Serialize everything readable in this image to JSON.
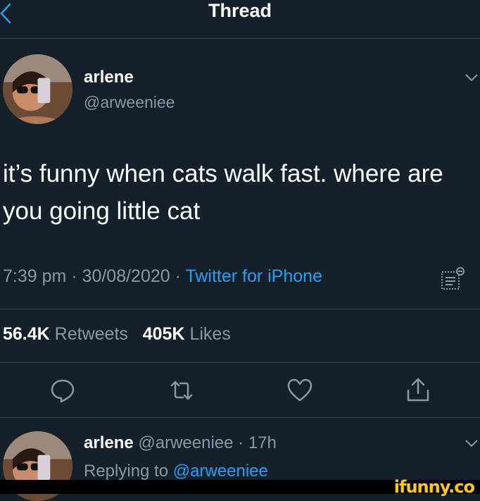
{
  "header": {
    "title": "Thread"
  },
  "tweet": {
    "author_name": "arlene",
    "author_handle": "@arweeniee",
    "text": "it’s funny when cats walk fast. where are you going little cat",
    "time_date": "7:39 pm · 30/08/2020 · ",
    "source": "Twitter for iPhone",
    "retweets_count": "56.4K",
    "retweets_label": "Retweets",
    "likes_count": "405K",
    "likes_label": "Likes"
  },
  "reply": {
    "author_name": "arlene",
    "author_handle_time": "@arweeniee · 17h",
    "replying_prefix": "Replying to ",
    "replying_handle": "@arweeniee"
  },
  "watermark": {
    "text": "ifunny.co"
  },
  "icons": {
    "back": "chevron-left-icon",
    "analytics": "analytics-icon",
    "reply": "comment-icon",
    "retweet": "retweet-icon",
    "like": "heart-icon",
    "share": "share-icon"
  },
  "colors": {
    "background": "#15202b",
    "accent": "#1da1f2",
    "secondary_text": "#8899a6",
    "divider": "#38444d",
    "watermark": "#ffcc00"
  }
}
